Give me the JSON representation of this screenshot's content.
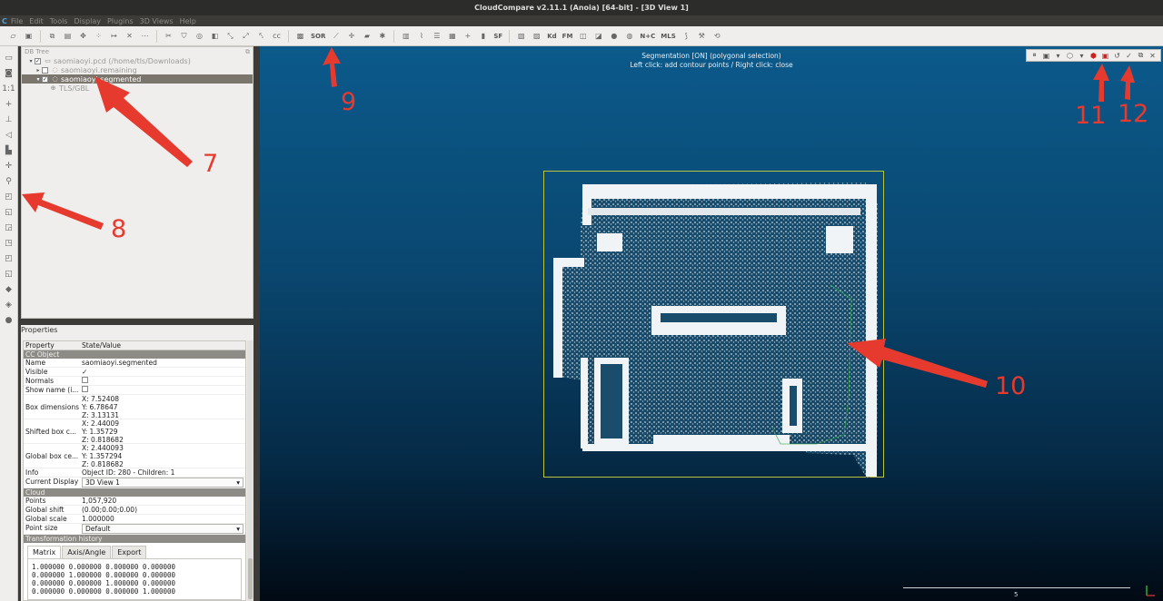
{
  "window": {
    "title": "CloudCompare v2.11.1 (Anoia) [64-bit] - [3D View 1]"
  },
  "menu": {
    "items": [
      "File",
      "Edit",
      "Tools",
      "Display",
      "Plugins",
      "3D Views",
      "Help"
    ]
  },
  "toolbar": {
    "sor_label": "SOR",
    "sf_label": "SF",
    "kd_label": "Kd",
    "fm_label": "FM",
    "nc_label": "N+C",
    "mls_label": "MLS"
  },
  "db_tree": {
    "title": "DB Tree",
    "items": [
      {
        "label": "saomiaoyi.pcd (/home/tls/Downloads)",
        "selected": false
      },
      {
        "label": "saomiaoyi.remaining",
        "selected": false
      },
      {
        "label": "saomiaoyi.segmented",
        "selected": true
      },
      {
        "label": "TLS/GBL",
        "selected": false
      }
    ]
  },
  "properties": {
    "title": "Properties",
    "header": {
      "property": "Property",
      "value": "State/Value"
    },
    "sections": {
      "cc_object": "CC Object",
      "cloud": "Cloud",
      "transformation_history": "Transformation history"
    },
    "rows": {
      "name": {
        "k": "Name",
        "v": "saomiaoyi.segmented"
      },
      "visible": {
        "k": "Visible",
        "v": "✓"
      },
      "normals": {
        "k": "Normals",
        "v": ""
      },
      "show_name": {
        "k": "Show name (i...",
        "v": ""
      },
      "box_dimensions": {
        "k": "Box dimensions",
        "x": "X: 7.52408",
        "y": "Y: 6.78647",
        "z": "Z: 3.13131"
      },
      "shifted_box": {
        "k": "Shifted box c...",
        "x": "X: 2.44009",
        "y": "Y: 1.35729",
        "z": "Z: 0.818682"
      },
      "global_box": {
        "k": "Global box ce...",
        "x": "X: 2.440093",
        "y": "Y: 1.357294",
        "z": "Z: 0.818682"
      },
      "info": {
        "k": "Info",
        "v": "Object ID: 280 - Children: 1"
      },
      "current_display": {
        "k": "Current Display",
        "v": "3D View 1"
      },
      "points": {
        "k": "Points",
        "v": "1,057,920"
      },
      "global_shift": {
        "k": "Global shift",
        "v": "(0.00;0.00;0.00)"
      },
      "global_scale": {
        "k": "Global scale",
        "v": "1.000000"
      },
      "point_size": {
        "k": "Point size",
        "v": "Default"
      }
    },
    "tabs": [
      "Matrix",
      "Axis/Angle",
      "Export"
    ],
    "matrix": [
      "1.000000 0.000000 0.000000 0.000000",
      "0.000000 1.000000 0.000000 0.000000",
      "0.000000 0.000000 1.000000 0.000000",
      "0.000000 0.000000 0.000000 1.000000"
    ]
  },
  "view3d": {
    "line1": "Segmentation [ON] (polygonal selection)",
    "line2": "Left click: add contour points / Right click: close",
    "scale_label": "5"
  },
  "annotations": [
    "7",
    "8",
    "9",
    "10",
    "11",
    "12"
  ],
  "colors": {
    "annotation": "#e63a2e",
    "bbox": "#b8c43a",
    "selection": "#7b766d"
  }
}
